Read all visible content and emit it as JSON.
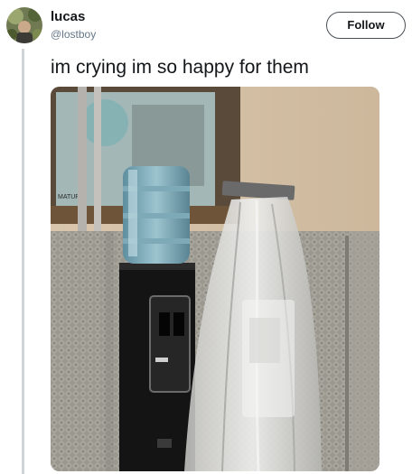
{
  "tweet": {
    "author": {
      "display_name": "lucas",
      "handle": "@lostboy",
      "avatar_icon": "avatar-photo"
    },
    "follow_label": "Follow",
    "text": "im crying im so happy for them",
    "media": {
      "kind": "photo",
      "icon": "photo-image"
    }
  },
  "colors": {
    "text_primary": "#14171a",
    "text_secondary": "#657786",
    "thread_line": "#cfd4d8",
    "follow_border": "#4a4f55"
  }
}
